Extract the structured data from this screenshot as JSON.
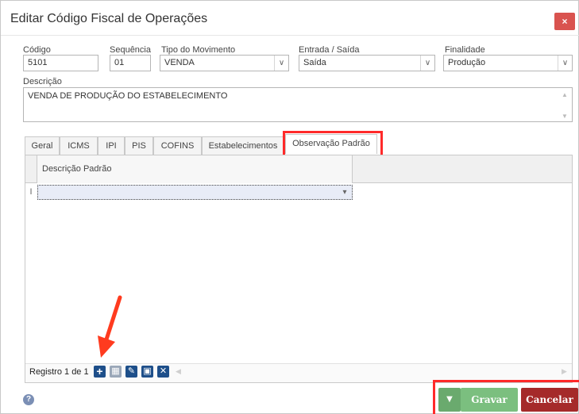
{
  "window": {
    "title": "Editar Código Fiscal de Operações",
    "close_icon": "×"
  },
  "form": {
    "codigo": {
      "label": "Código",
      "value": "5101"
    },
    "sequencia": {
      "label": "Sequência",
      "value": "01"
    },
    "tipo_movimento": {
      "label": "Tipo do Movimento",
      "value": "VENDA"
    },
    "entrada_saida": {
      "label": "Entrada / Saída",
      "value": "Saída"
    },
    "finalidade": {
      "label": "Finalidade",
      "value": "Produção"
    },
    "descricao": {
      "label": "Descrição",
      "value": "VENDA DE PRODUÇÃO DO ESTABELECIMENTO"
    },
    "dropdown_glyph": "∨"
  },
  "tabs": [
    {
      "label": "Geral"
    },
    {
      "label": "ICMS"
    },
    {
      "label": "IPI"
    },
    {
      "label": "PIS"
    },
    {
      "label": "COFINS"
    },
    {
      "label": "Estabelecimentos"
    },
    {
      "label": "Observação Padrão",
      "active": true
    }
  ],
  "grid": {
    "column_header": "Descrição Padrão",
    "row_indicator": "I",
    "cell_dropdown": "▾"
  },
  "pager": {
    "text": "Registro 1 de 1",
    "icons": [
      "plus-icon",
      "calendar-icon",
      "pencil-icon",
      "save-icon",
      "close-icon"
    ],
    "glyphs": {
      "add": "+",
      "calendar": "▦",
      "edit": "✎",
      "save": "▣",
      "delete": "✕",
      "left": "◀",
      "right": "▶"
    }
  },
  "footer": {
    "help_icon": "?",
    "gravar_label": "Gravar",
    "cancelar_label": "Cancelar",
    "gravar_arrow": "▼"
  },
  "colors": {
    "close": "#d9534f",
    "gravar": "#7bbf7f",
    "gravar_dark": "#6aaa6e",
    "cancelar": "#a52a2a",
    "highlight": "#ff2a2a",
    "annotation_arrow": "#ff3b1f",
    "pager_blue": "#1e4f8a"
  }
}
